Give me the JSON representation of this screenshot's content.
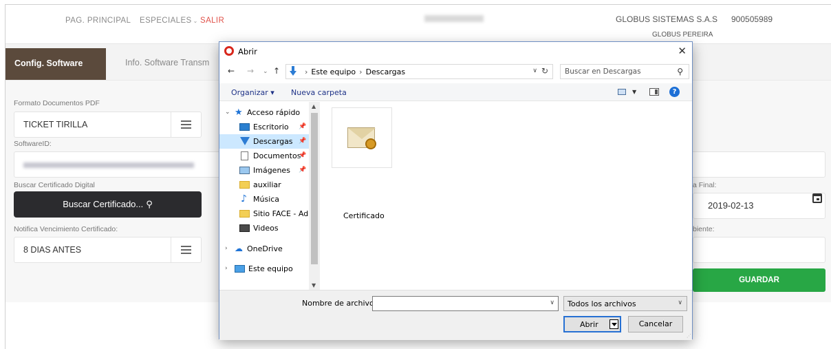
{
  "header": {
    "nav": {
      "home": "PAG. PRINCIPAL",
      "special": "ESPECIALES",
      "exit": "SALIR"
    },
    "company": "GLOBUS SISTEMAS S.A.S",
    "nit": "900505989",
    "branch": "GLOBUS PEREIRA"
  },
  "tabs": {
    "active": "Config. Software",
    "inactive": "Info. Software Transm"
  },
  "form": {
    "pdf_format_label": "Formato Documentos PDF",
    "pdf_format_value": "TICKET TIRILLA",
    "software_id_label": "SoftwareID:",
    "cert_label": "Buscar Certificado Digital",
    "cert_button": "Buscar Certificado...",
    "notify_label": "Notifica Vencimiento Certificado:",
    "notify_value": "8 DIAS ANTES",
    "final_date_label": "a Final:",
    "final_date_value": "2019-02-13",
    "env_label": "biente:",
    "save_button": "GUARDAR"
  },
  "dialog": {
    "title": "Abrir",
    "close": "✕",
    "path_parts": [
      "Este equipo",
      "Descargas"
    ],
    "search_placeholder": "Buscar en Descargas",
    "organize": "Organizar ▾",
    "new_folder": "Nueva carpeta",
    "tree": [
      {
        "label": "Acceso rápido",
        "icon": "quick-access-star-icon",
        "expander": "⌄"
      },
      {
        "label": "Escritorio",
        "icon": "desktop-icon",
        "pinned": true
      },
      {
        "label": "Descargas",
        "icon": "downloads-icon",
        "pinned": true,
        "selected": true
      },
      {
        "label": "Documentos",
        "icon": "documents-icon",
        "pinned": true
      },
      {
        "label": "Imágenes",
        "icon": "images-icon",
        "pinned": true
      },
      {
        "label": "auxiliar",
        "icon": "folder-icon"
      },
      {
        "label": "Música",
        "icon": "music-icon"
      },
      {
        "label": "Sitio FACE - Adn",
        "icon": "folder-icon"
      },
      {
        "label": "Videos",
        "icon": "videos-icon"
      },
      {
        "label": "OneDrive",
        "icon": "onedrive-icon",
        "expander": "›"
      },
      {
        "label": "Este equipo",
        "icon": "this-pc-icon",
        "expander": "›"
      }
    ],
    "files": [
      {
        "name": "Certificado",
        "icon": "certificate-file-icon"
      }
    ],
    "filename_label": "Nombre de archivo:",
    "filename_value": "",
    "filetype_value": "Todos los archivos",
    "open_button": "Abrir",
    "cancel_button": "Cancelar"
  },
  "colors": {
    "tab_active": "#5b4a3c",
    "save": "#28a745",
    "exit_link": "#e0524a",
    "selection": "#cce8ff"
  }
}
